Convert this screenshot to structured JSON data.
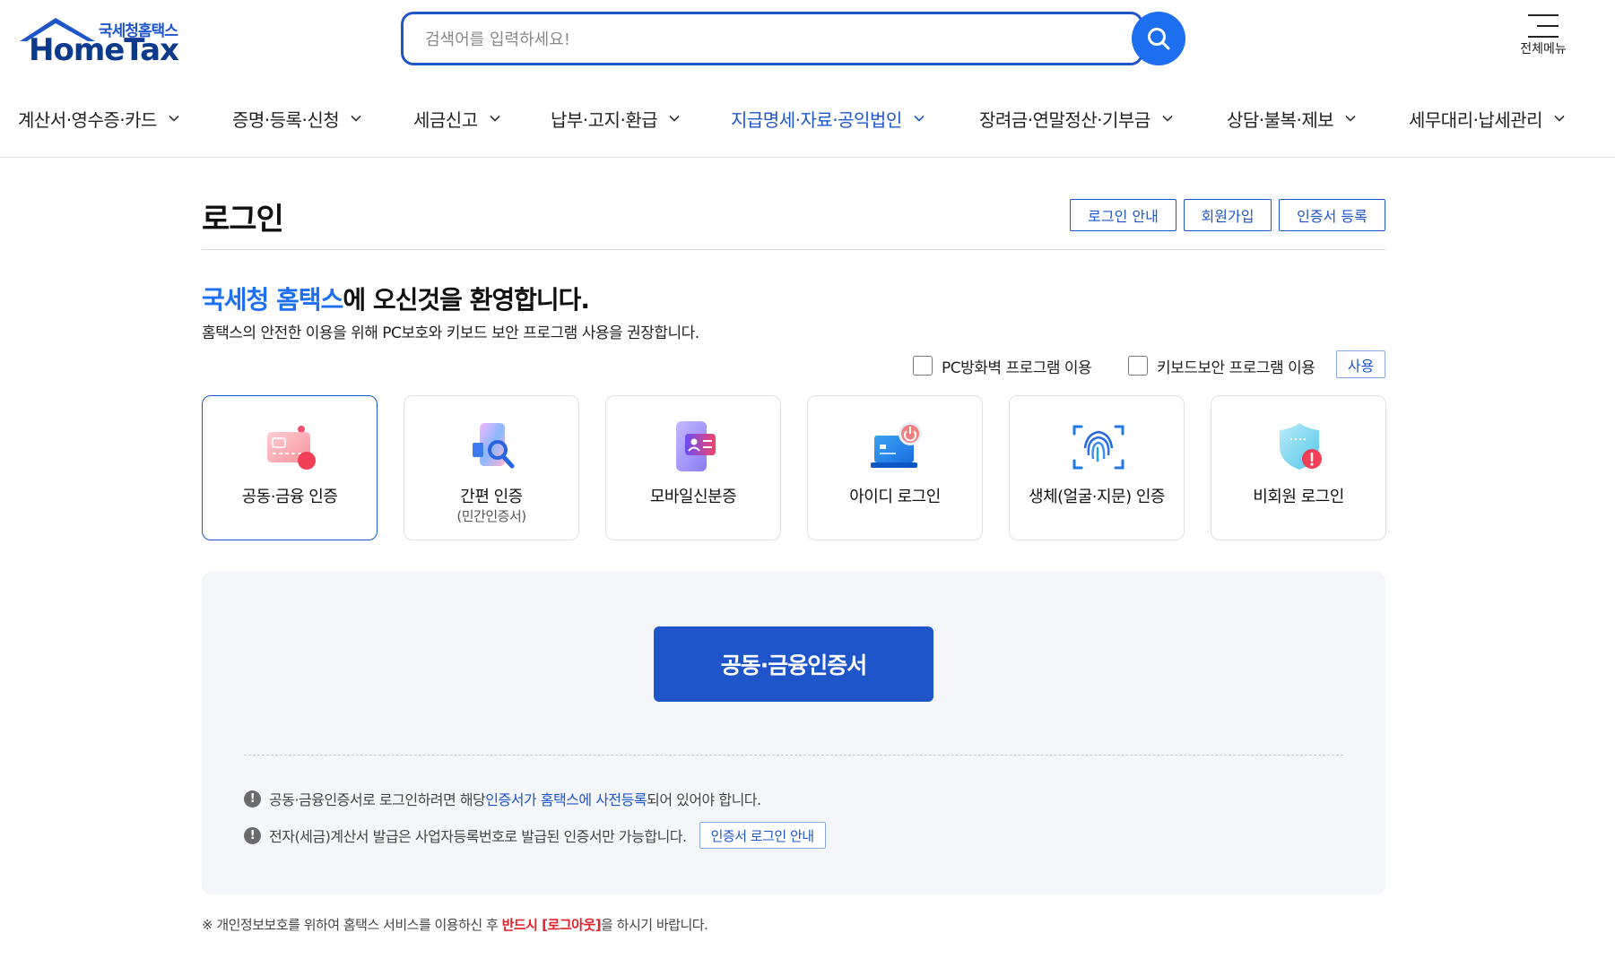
{
  "logo": {
    "sub_text": "국세청홈택스",
    "main_text": "HomeTax"
  },
  "search": {
    "placeholder": "검색어를 입력하세요!",
    "value": ""
  },
  "all_menu": {
    "label": "전체메뉴"
  },
  "gnb": {
    "items": [
      {
        "label": "계산서·영수증·카드",
        "active": false
      },
      {
        "label": "증명·등록·신청",
        "active": false
      },
      {
        "label": "세금신고",
        "active": false
      },
      {
        "label": "납부·고지·환급",
        "active": false
      },
      {
        "label": "지급명세·자료·공익법인",
        "active": true
      },
      {
        "label": "장려금·연말정산·기부금",
        "active": false
      },
      {
        "label": "상담·불복·제보",
        "active": false
      },
      {
        "label": "세무대리·납세관리",
        "active": false
      }
    ]
  },
  "page": {
    "title": "로그인",
    "buttons": {
      "login_guide": "로그인 안내",
      "signup": "회원가입",
      "cert_register": "인증서 등록"
    }
  },
  "welcome": {
    "highlight": "국세청 홈택스",
    "rest": "에 오신것을 환영합니다.",
    "recommend": "홈택스의 안전한 이용을 위해 PC보호와 키보드 보안 프로그램 사용을 권장합니다."
  },
  "security": {
    "firewall_label": "PC방화벽 프로그램 이용",
    "firewall_checked": false,
    "keyboard_label": "키보드보안 프로그램 이용",
    "keyboard_checked": false,
    "use_button": "사용"
  },
  "login_methods": [
    {
      "label": "공동·금융 인증",
      "sub": "",
      "icon": "certificate-card-icon",
      "active": true
    },
    {
      "label": "간편 인증",
      "sub": "(민간인증서)",
      "icon": "simple-auth-phone-icon",
      "active": false
    },
    {
      "label": "모바일신분증",
      "sub": "",
      "icon": "mobile-id-icon",
      "active": false
    },
    {
      "label": "아이디 로그인",
      "sub": "",
      "icon": "laptop-power-icon",
      "active": false
    },
    {
      "label": "생체(얼굴·지문) 인증",
      "sub": "",
      "icon": "fingerprint-icon",
      "active": false
    },
    {
      "label": "비회원 로그인",
      "sub": "",
      "icon": "shield-alert-icon",
      "active": false
    }
  ],
  "panel": {
    "main_button": "공동·금융인증서",
    "note1_pre": "공동·금융인증서로 로그인하려면 해당 ",
    "note1_link": "인증서가 홈택스에 사전등록",
    "note1_post": "되어 있어야 합니다.",
    "note2": "전자(세금)계산서 발급은 사업자등록번호로 발급된 인증서만 가능합니다.",
    "note2_button": "인증서 로그인 안내"
  },
  "footer": {
    "pre": "※ 개인정보보호를 위하여 홈택스 서비스를 이용하신 후 ",
    "warn": "반드시 [로그아웃]",
    "post": "을 하시기 바랍니다."
  },
  "colors": {
    "brand": "#1e56c9",
    "accent": "#1e6ef0",
    "warn": "#e0202a",
    "panel_bg": "#f4f6fa"
  }
}
